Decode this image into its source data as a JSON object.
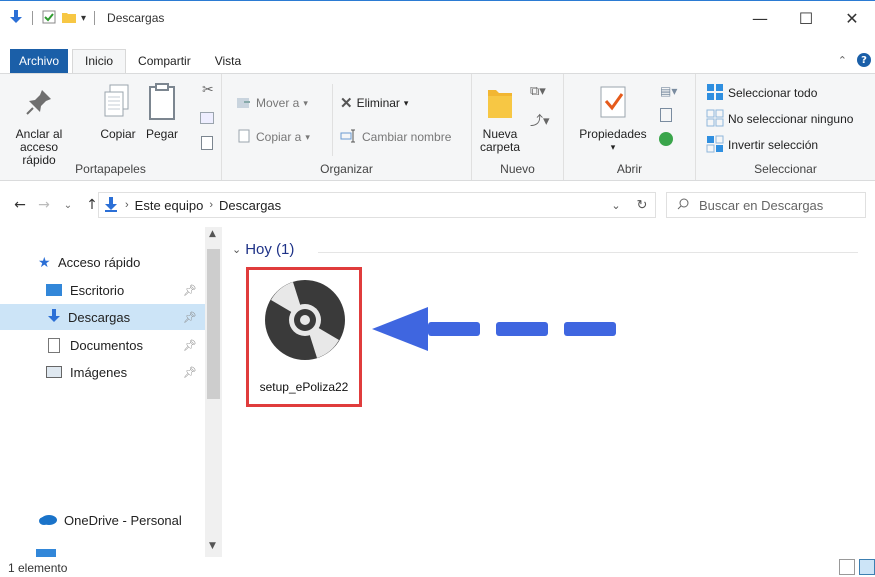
{
  "window": {
    "title": "Descargas",
    "controls": {
      "minimize": "—",
      "maximize": "☐",
      "close": "✕"
    }
  },
  "ribbon_tabs": [
    {
      "label": "Archivo"
    },
    {
      "label": "Inicio"
    },
    {
      "label": "Compartir"
    },
    {
      "label": "Vista"
    }
  ],
  "ribbon": {
    "portapapeles": {
      "label": "Portapapeles",
      "anclar": "Anclar al acceso rápido",
      "copiar": "Copiar",
      "pegar": "Pegar"
    },
    "organizar": {
      "label": "Organizar",
      "mover": "Mover a",
      "copiar_a": "Copiar a",
      "eliminar": "Eliminar",
      "cambiar_nombre": "Cambiar nombre"
    },
    "nuevo": {
      "label": "Nuevo",
      "nueva_carpeta": "Nueva carpeta"
    },
    "abrir": {
      "label": "Abrir",
      "propiedades": "Propiedades"
    },
    "seleccionar": {
      "label": "Seleccionar",
      "todo": "Seleccionar todo",
      "ninguno": "No seleccionar ninguno",
      "invertir": "Invertir selección"
    }
  },
  "address": {
    "crumbs": [
      "Este equipo",
      "Descargas"
    ],
    "search_placeholder": "Buscar en Descargas"
  },
  "nav_pane": {
    "quick_access": "Acceso rápido",
    "items": [
      {
        "label": "Escritorio"
      },
      {
        "label": "Descargas"
      },
      {
        "label": "Documentos"
      },
      {
        "label": "Imágenes"
      }
    ],
    "onedrive": "OneDrive - Personal"
  },
  "content": {
    "group_header": "Hoy (1)",
    "file_name": "setup_ePoliza22"
  },
  "status": {
    "count": "1 elemento"
  },
  "colors": {
    "accent": "#1b5fa8",
    "highlight_box": "#e03c3c",
    "arrow": "#3f66e0",
    "selection": "#cce4f7"
  }
}
